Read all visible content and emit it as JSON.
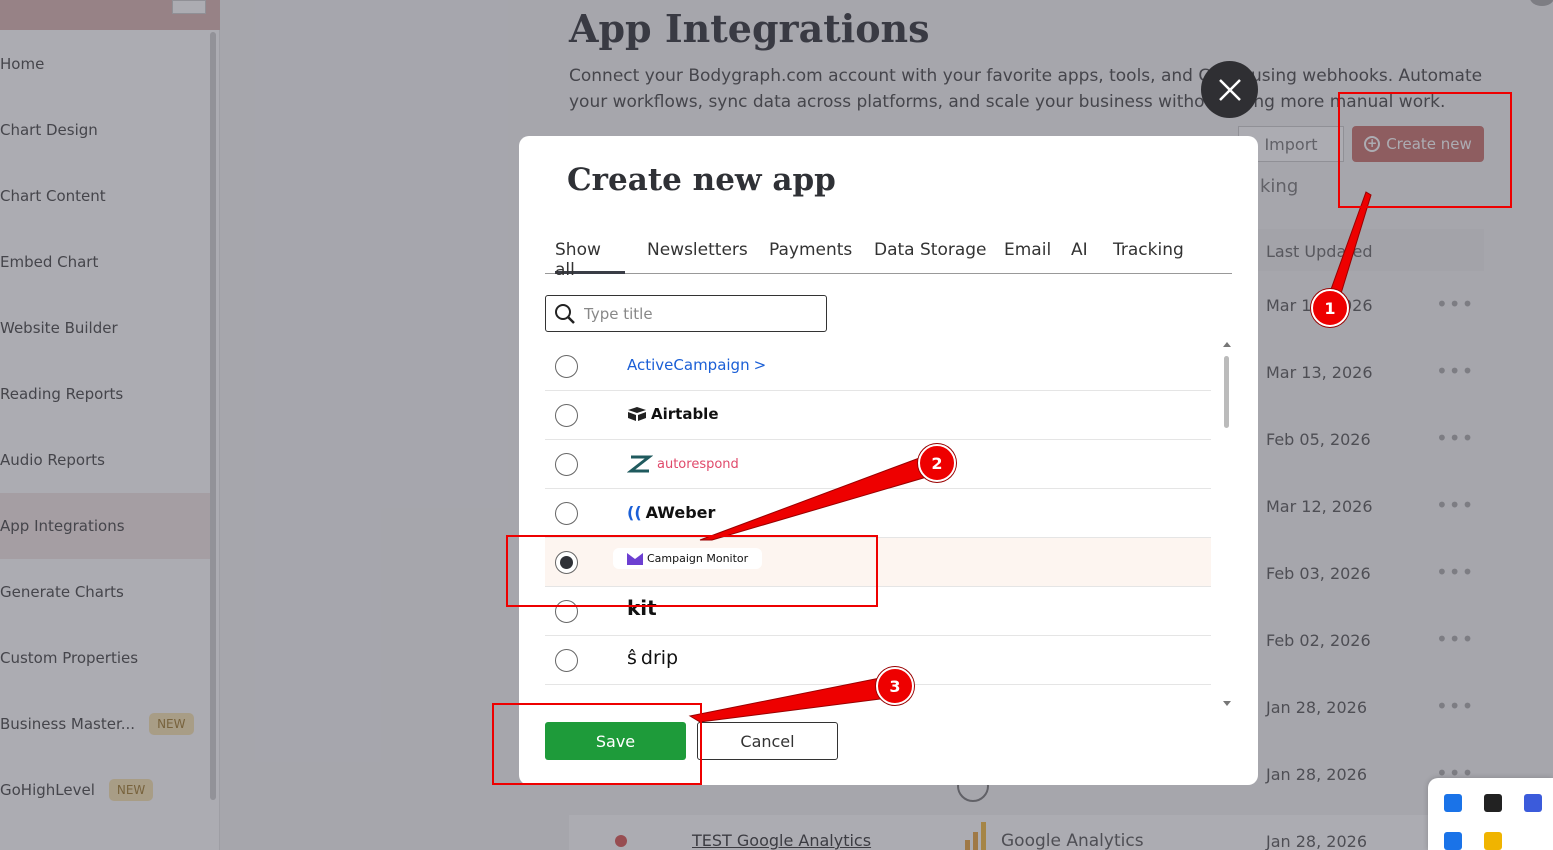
{
  "sidebar": {
    "items": [
      {
        "label": "Home"
      },
      {
        "label": "Chart Design"
      },
      {
        "label": "Chart Content"
      },
      {
        "label": "Embed Chart"
      },
      {
        "label": "Website Builder"
      },
      {
        "label": "Reading Reports"
      },
      {
        "label": "Audio Reports"
      },
      {
        "label": "App Integrations",
        "active": true
      },
      {
        "label": "Generate Charts"
      },
      {
        "label": "Custom Properties"
      },
      {
        "label": "Business Master...",
        "badge": "NEW"
      },
      {
        "label": "GoHighLevel",
        "badge": "NEW"
      }
    ]
  },
  "main": {
    "title": "App Integrations",
    "description": "Connect your Bodygraph.com account with your favorite apps, tools, and CRMs using webhooks. Automate your workflows, sync data across platforms, and scale your business without doing more manual work.",
    "import_label": "Import",
    "create_label": "Create new",
    "search_fragment": "king",
    "table_header_last": "Last Updated",
    "dates": [
      "Mar 13, 2026",
      "Mar 13, 2026",
      "Feb 05, 2026",
      "Mar 12, 2026",
      "Feb 03, 2026",
      "Feb 02, 2026",
      "Jan 28, 2026",
      "Jan 28, 2026",
      "Jan 28, 2026"
    ],
    "dots": "•••",
    "bottom_row": {
      "name": "TEST Google Analytics",
      "app": "Google Analytics",
      "date": "Jan 28, 2026"
    }
  },
  "modal": {
    "title": "Create new app",
    "tabs": [
      "Show all",
      "Newsletters",
      "Payments",
      "Data Storage",
      "Email",
      "AI",
      "Tracking"
    ],
    "active_tab": "Show all",
    "search_placeholder": "Type title",
    "apps": [
      {
        "name": "ActiveCampaign",
        "selected": false
      },
      {
        "name": "Airtable",
        "selected": false
      },
      {
        "name": "autorespond",
        "selected": false
      },
      {
        "name": "AWeber",
        "selected": false
      },
      {
        "name": "Campaign Monitor",
        "selected": true
      },
      {
        "name": "kit",
        "selected": false
      },
      {
        "name": "drip",
        "selected": false
      }
    ],
    "save_label": "Save",
    "cancel_label": "Cancel"
  },
  "annotations": {
    "badges": [
      "1",
      "2",
      "3"
    ],
    "color": "#e00000"
  },
  "colors": {
    "save": "#1e9b3a",
    "create": "#c9706a",
    "accent": "#2f3136"
  }
}
